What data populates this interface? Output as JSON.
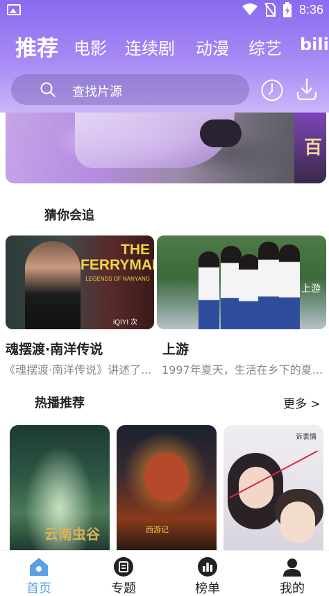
{
  "status_bar": {
    "time": "8:36"
  },
  "tabs": [
    {
      "label": "推荐",
      "active": true
    },
    {
      "label": "电影"
    },
    {
      "label": "连续剧"
    },
    {
      "label": "动漫"
    },
    {
      "label": "综艺"
    },
    {
      "label": "bili"
    }
  ],
  "search": {
    "placeholder": "查找片源"
  },
  "banner": {
    "art_text": "百"
  },
  "guess": {
    "title": "猜你会追",
    "items": [
      {
        "title": "魂摆渡·南洋传说",
        "desc": "《魂摆渡·南洋传说》讲述了...",
        "art_title": "THE FERRYMAN",
        "art_subtitle": "LEGENDS OF NANYANG",
        "art_badge": "iQIYI 次"
      },
      {
        "title": "上游",
        "desc": "1997年夏天，生活在乡下的夏...",
        "art_text": "上游"
      }
    ]
  },
  "hot": {
    "title": "热播推荐",
    "more": "更多 >",
    "posters": [
      {
        "art_text": "云南虫谷"
      },
      {
        "art_text": "西游记"
      },
      {
        "art_text": "诉衷情"
      }
    ]
  },
  "nav": [
    {
      "label": "首页",
      "icon": "home-icon",
      "active": true
    },
    {
      "label": "专题",
      "icon": "topic-icon"
    },
    {
      "label": "榜单",
      "icon": "chart-icon"
    },
    {
      "label": "我的",
      "icon": "profile-icon"
    }
  ],
  "colors": {
    "accent": "#8a6af0",
    "nav_active": "#5aa0e8"
  }
}
